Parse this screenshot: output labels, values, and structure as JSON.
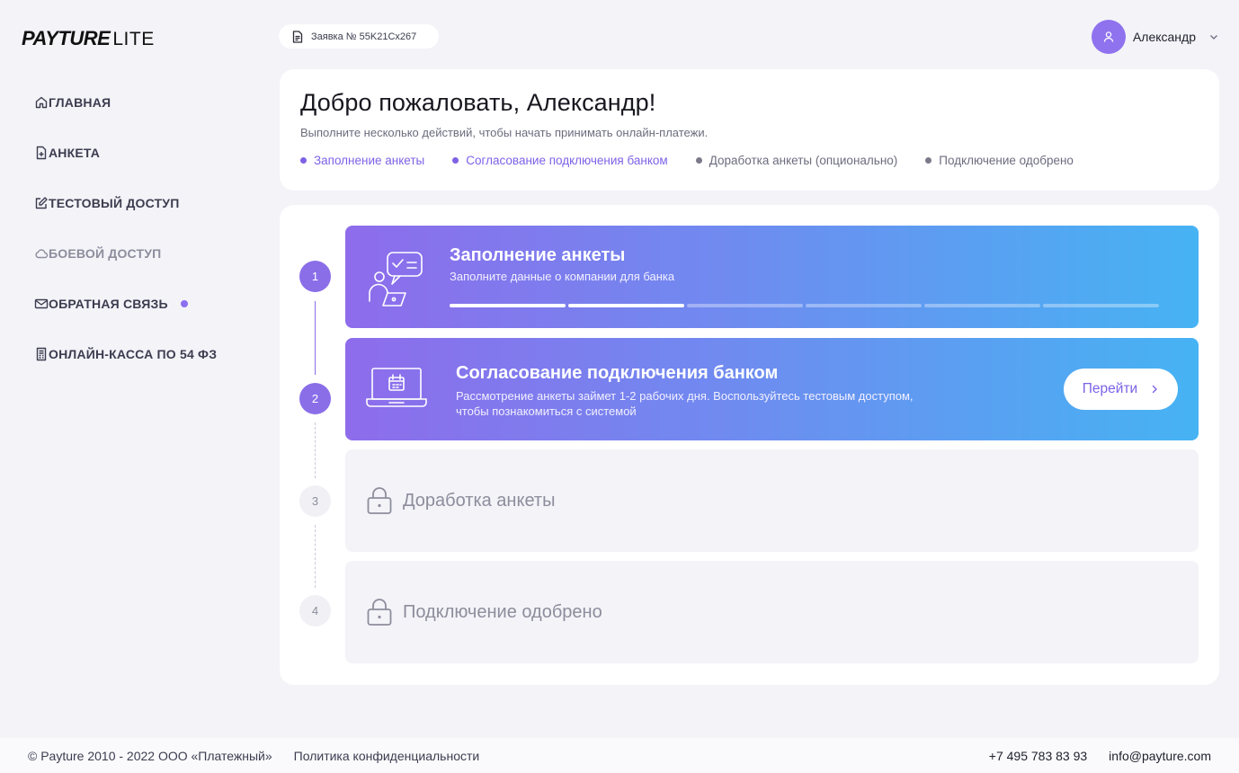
{
  "logo": {
    "main": "PAYTURE",
    "suffix": "LITE"
  },
  "sidebar": {
    "items": [
      {
        "label": "ГЛАВНАЯ",
        "icon": "home-icon"
      },
      {
        "label": "АНКЕТА",
        "icon": "document-plus-icon"
      },
      {
        "label": "ТЕСТОВЫЙ ДОСТУП",
        "icon": "edit-icon"
      },
      {
        "label": "БОЕВОЙ ДОСТУП",
        "icon": "cloud-icon",
        "disabled": true
      },
      {
        "label": "ОБРАТНАЯ СВЯЗЬ",
        "icon": "mail-icon",
        "badge_dot": true
      },
      {
        "label": "ОНЛАЙН-КАССА ПО 54 ФЗ",
        "icon": "receipt-icon"
      }
    ]
  },
  "header": {
    "request_label": "Заявка № 55K21Cx267",
    "user_name": "Александр"
  },
  "welcome": {
    "title": "Добро пожаловать, Александр!",
    "subtitle": "Выполните несколько действий, чтобы начать принимать онлайн-платежи.",
    "steps": [
      {
        "label": "Заполнение анкеты",
        "state": "active"
      },
      {
        "label": "Согласование подключения банком",
        "state": "active"
      },
      {
        "label": "Доработка анкеты (опционально)",
        "state": "inactive"
      },
      {
        "label": "Подключение одобрено",
        "state": "inactive"
      }
    ]
  },
  "stages": [
    {
      "number": "1",
      "title": "Заполнение анкеты",
      "desc": "Заполните данные о компании для банка",
      "progress_done": 2,
      "progress_total": 6
    },
    {
      "number": "2",
      "title": "Согласование подключения банком",
      "desc_line1": "Рассмотрение анкеты займет 1-2 рабочих дня. Воспользуйтесь тестовым доступом,",
      "desc_line2": "чтобы познакомиться с системой",
      "button": "Перейти"
    },
    {
      "number": "3",
      "title": "Доработка анкеты"
    },
    {
      "number": "4",
      "title": "Подключение одобрено"
    }
  ],
  "footer": {
    "copyright": "© Payture 2010 - 2022 ООО «Платежный»",
    "privacy": "Политика конфиденциальности",
    "phone": "+7 495 783 83 93",
    "email": "info@payture.com"
  },
  "colors": {
    "accent": "#8a6ee8",
    "gradient_start": "#8e6ceb",
    "gradient_end": "#46b3f3",
    "background": "#F3F3F8"
  }
}
